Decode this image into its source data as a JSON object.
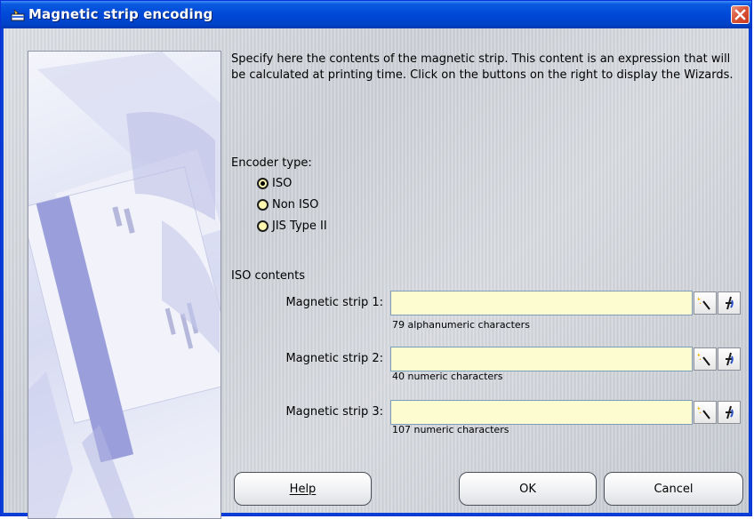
{
  "window": {
    "title": "Magnetic strip encoding"
  },
  "description": "Specify here the contents of the magnetic strip. This content is an expression that will be calculated at printing time. Click on the buttons on the right to display the Wizards.",
  "encoder": {
    "label": "Encoder type:",
    "options": [
      {
        "label": "ISO",
        "checked": true
      },
      {
        "label": "Non ISO",
        "checked": false
      },
      {
        "label": "JIS Type II",
        "checked": false
      }
    ]
  },
  "iso": {
    "section_label": "ISO contents",
    "strips": [
      {
        "label": "Magnetic strip 1:",
        "value": "",
        "hint": "79 alphanumeric characters"
      },
      {
        "label": "Magnetic strip 2:",
        "value": "",
        "hint": "40 numeric characters"
      },
      {
        "label": "Magnetic strip 3:",
        "value": "",
        "hint": "107 numeric characters"
      }
    ]
  },
  "buttons": {
    "help": "Help",
    "ok": "OK",
    "cancel": "Cancel"
  },
  "icons": {
    "title": "window-app-icon",
    "wizard": "wizard-wand-icon",
    "expression": "expression-builder-icon",
    "close": "close-icon"
  },
  "colors": {
    "titlebar": "#0048d8",
    "input_bg": "#fdfcd0",
    "close": "#d9553a"
  }
}
